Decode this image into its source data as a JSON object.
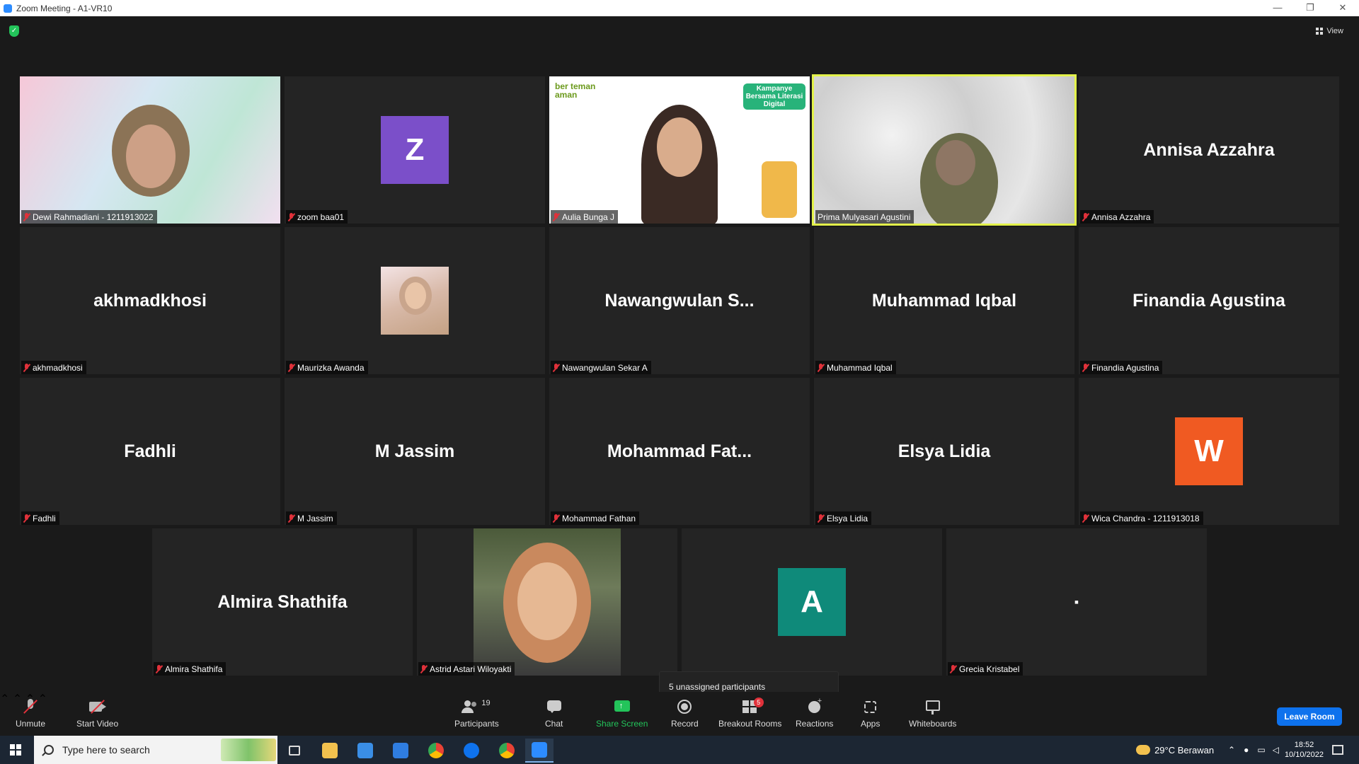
{
  "window": {
    "title": "Zoom Meeting - A1-VR10",
    "min": "—",
    "restore": "❐",
    "close": "✕"
  },
  "top": {
    "view_label": "View"
  },
  "tiles": [
    {
      "name": "Dewi Rahmadiani - 1211913022",
      "kind": "video"
    },
    {
      "name": "zoom baa01",
      "kind": "avatar",
      "letter": "Z",
      "color": "#7b4fc9"
    },
    {
      "name": "Aulia Bunga J",
      "kind": "video"
    },
    {
      "name": "Prima Mulyasari Agustini",
      "kind": "video",
      "active": true
    },
    {
      "name": "Annisa Azzahra",
      "kind": "text",
      "big": "Annisa Azzahra"
    },
    {
      "name": "akhmadkhosi",
      "kind": "text",
      "big": "akhmadkhosi"
    },
    {
      "name": "Maurizka Awanda",
      "kind": "photo"
    },
    {
      "name": "Nawangwulan Sekar A",
      "kind": "text",
      "big": "Nawangwulan  S..."
    },
    {
      "name": "Muhammad Iqbal",
      "kind": "text",
      "big": "Muhammad Iqbal"
    },
    {
      "name": "Finandia Agustina",
      "kind": "text",
      "big": "Finandia Agustina"
    },
    {
      "name": "Fadhli",
      "kind": "text",
      "big": "Fadhli"
    },
    {
      "name": "M Jassim",
      "kind": "text",
      "big": "M Jassim"
    },
    {
      "name": "Mohammad Fathan",
      "kind": "text",
      "big": "Mohammad  Fat..."
    },
    {
      "name": "Elsya Lidia",
      "kind": "text",
      "big": "Elsya Lidia"
    },
    {
      "name": "Wica Chandra - 1211913018",
      "kind": "avatar",
      "letter": "W",
      "color": "#f05a22"
    },
    {
      "name": "Almira Shathifa",
      "kind": "text",
      "big": "Almira Shathifa"
    },
    {
      "name": "Astrid Astari Wiloyakti",
      "kind": "video"
    },
    {
      "name": "",
      "kind": "avatar",
      "letter": "A",
      "color": "#0f8a7a"
    },
    {
      "name": "Grecia Kristabel",
      "kind": "text",
      "big": "▪"
    }
  ],
  "aulia_overlay": {
    "brand": "ber teman aman",
    "campaign": "Kampanye Bersama Literasi Digital"
  },
  "tooltip": "5 unassigned participants",
  "toolbar": {
    "unmute": "Unmute",
    "start_video": "Start Video",
    "participants": "Participants",
    "participants_count": "19",
    "chat": "Chat",
    "share_screen": "Share Screen",
    "record": "Record",
    "breakout_rooms": "Breakout Rooms",
    "breakout_badge": "5",
    "reactions": "Reactions",
    "apps": "Apps",
    "whiteboards": "Whiteboards",
    "leave": "Leave Room"
  },
  "taskbar": {
    "search_placeholder": "Type here to search",
    "weather": "29°C  Berawan",
    "time": "18:52",
    "date": "10/10/2022"
  },
  "colors": {
    "accent": "#0e72ed",
    "active_speaker": "#e3f24a",
    "share_green": "#23c45a",
    "mute_red": "#e0313a"
  }
}
